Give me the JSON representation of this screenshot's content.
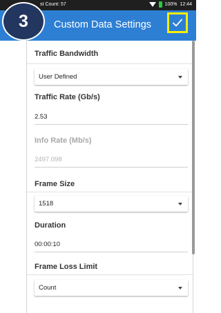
{
  "status_bar": {
    "left_text": "st Count: 57",
    "battery": "100%",
    "time": "12:44"
  },
  "app_bar": {
    "title": "Custom Data Settings",
    "confirm_icon": "check-icon"
  },
  "step_badge": "3",
  "fields": {
    "traffic_bandwidth": {
      "label": "Traffic Bandwidth",
      "value": "User Defined"
    },
    "traffic_rate": {
      "label": "Traffic Rate (Gb/s)",
      "value": "2.53"
    },
    "info_rate": {
      "label": "Info Rate (Mb/s)",
      "value": "2497.098"
    },
    "frame_size": {
      "label": "Frame Size",
      "value": "1518"
    },
    "duration": {
      "label": "Duration",
      "value": "00:00:10"
    },
    "frame_loss_limit": {
      "label": "Frame Loss Limit",
      "value": "Count"
    }
  },
  "colors": {
    "app_bar": "#2d7fd3",
    "badge": "#23365f",
    "highlight": "#ffee00",
    "battery": "#27c93f"
  }
}
